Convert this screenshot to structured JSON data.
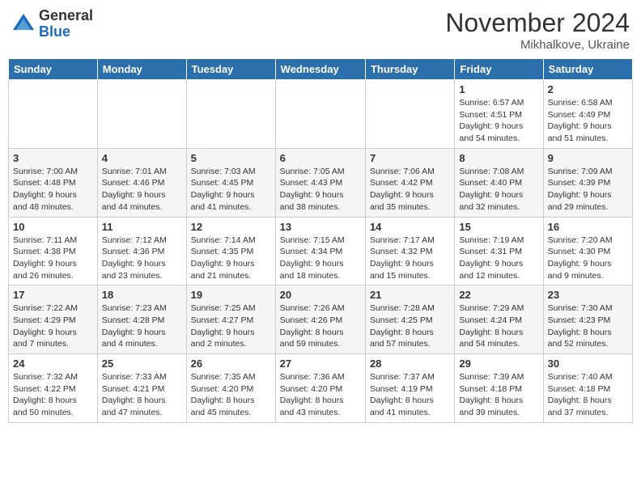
{
  "logo": {
    "general": "General",
    "blue": "Blue"
  },
  "title": "November 2024",
  "location": "Mikhalkove, Ukraine",
  "days_header": [
    "Sunday",
    "Monday",
    "Tuesday",
    "Wednesday",
    "Thursday",
    "Friday",
    "Saturday"
  ],
  "weeks": [
    [
      {
        "day": "",
        "info": ""
      },
      {
        "day": "",
        "info": ""
      },
      {
        "day": "",
        "info": ""
      },
      {
        "day": "",
        "info": ""
      },
      {
        "day": "",
        "info": ""
      },
      {
        "day": "1",
        "info": "Sunrise: 6:57 AM\nSunset: 4:51 PM\nDaylight: 9 hours\nand 54 minutes."
      },
      {
        "day": "2",
        "info": "Sunrise: 6:58 AM\nSunset: 4:49 PM\nDaylight: 9 hours\nand 51 minutes."
      }
    ],
    [
      {
        "day": "3",
        "info": "Sunrise: 7:00 AM\nSunset: 4:48 PM\nDaylight: 9 hours\nand 48 minutes."
      },
      {
        "day": "4",
        "info": "Sunrise: 7:01 AM\nSunset: 4:46 PM\nDaylight: 9 hours\nand 44 minutes."
      },
      {
        "day": "5",
        "info": "Sunrise: 7:03 AM\nSunset: 4:45 PM\nDaylight: 9 hours\nand 41 minutes."
      },
      {
        "day": "6",
        "info": "Sunrise: 7:05 AM\nSunset: 4:43 PM\nDaylight: 9 hours\nand 38 minutes."
      },
      {
        "day": "7",
        "info": "Sunrise: 7:06 AM\nSunset: 4:42 PM\nDaylight: 9 hours\nand 35 minutes."
      },
      {
        "day": "8",
        "info": "Sunrise: 7:08 AM\nSunset: 4:40 PM\nDaylight: 9 hours\nand 32 minutes."
      },
      {
        "day": "9",
        "info": "Sunrise: 7:09 AM\nSunset: 4:39 PM\nDaylight: 9 hours\nand 29 minutes."
      }
    ],
    [
      {
        "day": "10",
        "info": "Sunrise: 7:11 AM\nSunset: 4:38 PM\nDaylight: 9 hours\nand 26 minutes."
      },
      {
        "day": "11",
        "info": "Sunrise: 7:12 AM\nSunset: 4:36 PM\nDaylight: 9 hours\nand 23 minutes."
      },
      {
        "day": "12",
        "info": "Sunrise: 7:14 AM\nSunset: 4:35 PM\nDaylight: 9 hours\nand 21 minutes."
      },
      {
        "day": "13",
        "info": "Sunrise: 7:15 AM\nSunset: 4:34 PM\nDaylight: 9 hours\nand 18 minutes."
      },
      {
        "day": "14",
        "info": "Sunrise: 7:17 AM\nSunset: 4:32 PM\nDaylight: 9 hours\nand 15 minutes."
      },
      {
        "day": "15",
        "info": "Sunrise: 7:19 AM\nSunset: 4:31 PM\nDaylight: 9 hours\nand 12 minutes."
      },
      {
        "day": "16",
        "info": "Sunrise: 7:20 AM\nSunset: 4:30 PM\nDaylight: 9 hours\nand 9 minutes."
      }
    ],
    [
      {
        "day": "17",
        "info": "Sunrise: 7:22 AM\nSunset: 4:29 PM\nDaylight: 9 hours\nand 7 minutes."
      },
      {
        "day": "18",
        "info": "Sunrise: 7:23 AM\nSunset: 4:28 PM\nDaylight: 9 hours\nand 4 minutes."
      },
      {
        "day": "19",
        "info": "Sunrise: 7:25 AM\nSunset: 4:27 PM\nDaylight: 9 hours\nand 2 minutes."
      },
      {
        "day": "20",
        "info": "Sunrise: 7:26 AM\nSunset: 4:26 PM\nDaylight: 8 hours\nand 59 minutes."
      },
      {
        "day": "21",
        "info": "Sunrise: 7:28 AM\nSunset: 4:25 PM\nDaylight: 8 hours\nand 57 minutes."
      },
      {
        "day": "22",
        "info": "Sunrise: 7:29 AM\nSunset: 4:24 PM\nDaylight: 8 hours\nand 54 minutes."
      },
      {
        "day": "23",
        "info": "Sunrise: 7:30 AM\nSunset: 4:23 PM\nDaylight: 8 hours\nand 52 minutes."
      }
    ],
    [
      {
        "day": "24",
        "info": "Sunrise: 7:32 AM\nSunset: 4:22 PM\nDaylight: 8 hours\nand 50 minutes."
      },
      {
        "day": "25",
        "info": "Sunrise: 7:33 AM\nSunset: 4:21 PM\nDaylight: 8 hours\nand 47 minutes."
      },
      {
        "day": "26",
        "info": "Sunrise: 7:35 AM\nSunset: 4:20 PM\nDaylight: 8 hours\nand 45 minutes."
      },
      {
        "day": "27",
        "info": "Sunrise: 7:36 AM\nSunset: 4:20 PM\nDaylight: 8 hours\nand 43 minutes."
      },
      {
        "day": "28",
        "info": "Sunrise: 7:37 AM\nSunset: 4:19 PM\nDaylight: 8 hours\nand 41 minutes."
      },
      {
        "day": "29",
        "info": "Sunrise: 7:39 AM\nSunset: 4:18 PM\nDaylight: 8 hours\nand 39 minutes."
      },
      {
        "day": "30",
        "info": "Sunrise: 7:40 AM\nSunset: 4:18 PM\nDaylight: 8 hours\nand 37 minutes."
      }
    ]
  ]
}
